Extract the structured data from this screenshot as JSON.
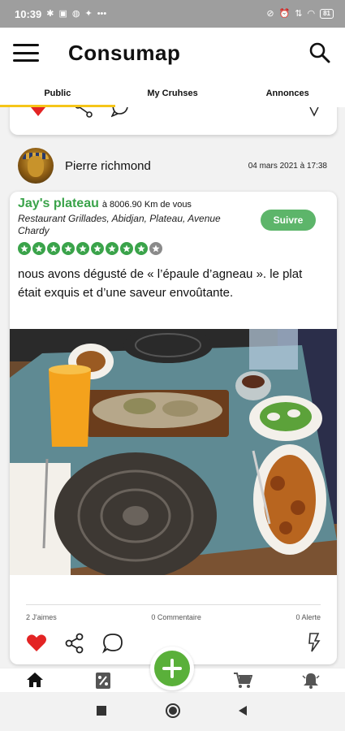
{
  "status_bar": {
    "time": "10:39",
    "battery": "81"
  },
  "app_bar": {
    "title": "Consumap",
    "menu_icon": "hamburger-menu-icon",
    "search_icon": "search-icon"
  },
  "tabs": [
    {
      "label": "Public",
      "active": true
    },
    {
      "label": "My Cruhses",
      "active": false
    },
    {
      "label": "Annonces",
      "active": false
    }
  ],
  "post": {
    "author": "Pierre richmond",
    "date": "04 mars 2021 à 17:38",
    "place_name": "Jay's plateau",
    "distance": "à 8006.90 Km de vous",
    "place_description": "Restaurant Grillades, Abidjan, Plateau, Avenue Chardy",
    "follow_label": "Suivre",
    "rating": {
      "filled": 9,
      "total": 10
    },
    "text": "nous avons dégusté de « l’épaule d’agneau ». le plat était exquis et d’une saveur envoûtante.",
    "likes": "2 J'aimes",
    "comments": "0 Commentaire",
    "alerts": "0 Alerte"
  },
  "colors": {
    "accent_green": "#3aa34a",
    "tab_indicator": "#f5c518",
    "like_red": "#e32424",
    "fab_green": "#5ab03a"
  },
  "bottom_nav": [
    "home-icon",
    "discount-icon",
    "add-icon",
    "cart-icon",
    "notification-bell-icon"
  ]
}
